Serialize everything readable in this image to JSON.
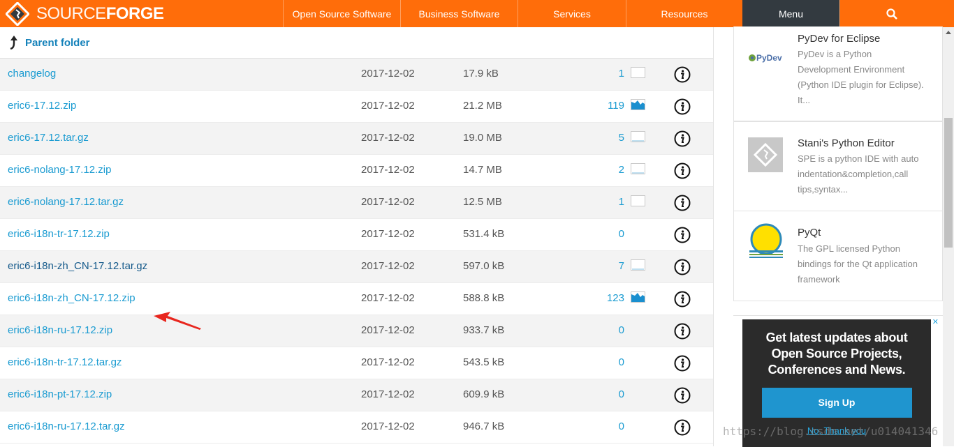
{
  "header": {
    "logo_text_thin": "SOURCE",
    "logo_text_bold": "FORGE",
    "brand_color": "#ff6d0a",
    "nav": [
      {
        "label": "Open Source Software"
      },
      {
        "label": "Business Software"
      },
      {
        "label": "Services"
      },
      {
        "label": "Resources"
      },
      {
        "label": "Menu"
      }
    ],
    "search_icon": "search-icon"
  },
  "files": {
    "parent_label": "Parent folder",
    "rows": [
      {
        "name": "changelog",
        "date": "2017-12-02",
        "size": "17.9 kB",
        "downloads": "1",
        "spark": "empty"
      },
      {
        "name": "eric6-17.12.zip",
        "date": "2017-12-02",
        "size": "21.2 MB",
        "downloads": "119",
        "spark": "filled"
      },
      {
        "name": "eric6-17.12.tar.gz",
        "date": "2017-12-02",
        "size": "19.0 MB",
        "downloads": "5",
        "spark": "low"
      },
      {
        "name": "eric6-nolang-17.12.zip",
        "date": "2017-12-02",
        "size": "14.7 MB",
        "downloads": "2",
        "spark": "low"
      },
      {
        "name": "eric6-nolang-17.12.tar.gz",
        "date": "2017-12-02",
        "size": "12.5 MB",
        "downloads": "1",
        "spark": "empty"
      },
      {
        "name": "eric6-i18n-tr-17.12.zip",
        "date": "2017-12-02",
        "size": "531.4 kB",
        "downloads": "0",
        "spark": "none"
      },
      {
        "name": "eric6-i18n-zh_CN-17.12.tar.gz",
        "date": "2017-12-02",
        "size": "597.0 kB",
        "downloads": "7",
        "spark": "low"
      },
      {
        "name": "eric6-i18n-zh_CN-17.12.zip",
        "date": "2017-12-02",
        "size": "588.8 kB",
        "downloads": "123",
        "spark": "filled"
      },
      {
        "name": "eric6-i18n-ru-17.12.zip",
        "date": "2017-12-02",
        "size": "933.7 kB",
        "downloads": "0",
        "spark": "none"
      },
      {
        "name": "eric6-i18n-tr-17.12.tar.gz",
        "date": "2017-12-02",
        "size": "543.5 kB",
        "downloads": "0",
        "spark": "none"
      },
      {
        "name": "eric6-i18n-pt-17.12.zip",
        "date": "2017-12-02",
        "size": "609.9 kB",
        "downloads": "0",
        "spark": "none"
      },
      {
        "name": "eric6-i18n-ru-17.12.tar.gz",
        "date": "2017-12-02",
        "size": "946.7 kB",
        "downloads": "0",
        "spark": "none"
      }
    ]
  },
  "sidebar": {
    "projects": [
      {
        "name": "PyDev for Eclipse",
        "logo_text": "PyDev",
        "desc": [
          "PyDev is a Python",
          "Development Environment",
          "(Python IDE plugin for Eclipse).",
          "It..."
        ]
      },
      {
        "name": "Stani's Python Editor",
        "desc": [
          "SPE is a python IDE with auto",
          "indentation&completion,call",
          "tips,syntax..."
        ]
      },
      {
        "name": "PyQt",
        "desc": [
          "The GPL licensed Python",
          "bindings for the Qt application",
          "framework"
        ]
      }
    ],
    "newsletter": {
      "headline": [
        "Get latest updates about",
        "Open Source Projects,",
        "Conferences and News."
      ],
      "signup_label": "Sign Up",
      "decline_label": "No, Thank you"
    },
    "ad_close": "✕"
  },
  "watermark": "https://blog.csdn.net/u014041346"
}
